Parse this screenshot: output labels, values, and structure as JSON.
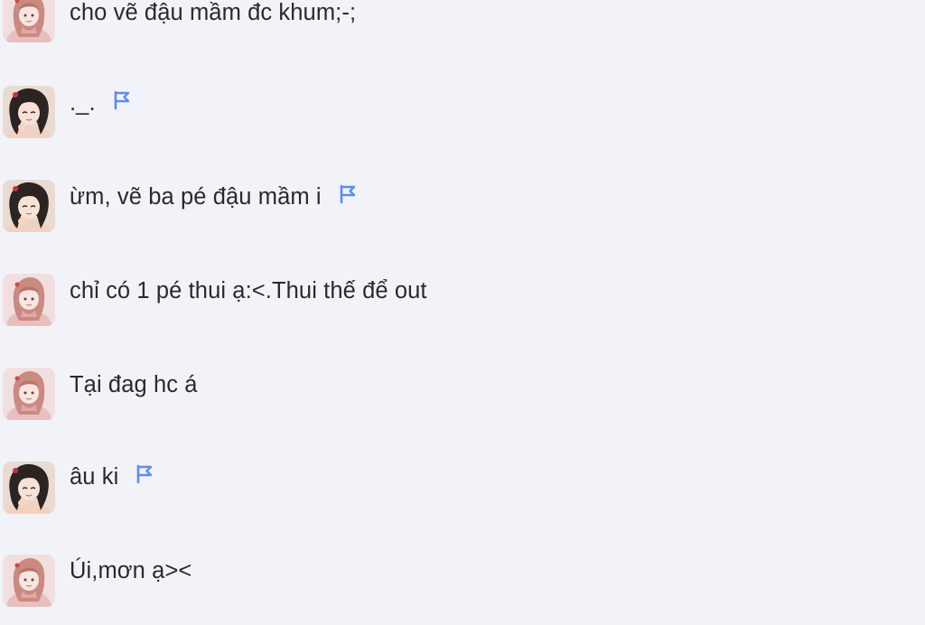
{
  "messages": [
    {
      "text": "cho vẽ đậu mầm đc khum;-;",
      "avatar": "avatar-girl-pink",
      "flag": false
    },
    {
      "text": "._.",
      "avatar": "avatar-girl-dark",
      "flag": true
    },
    {
      "text": "ừm, vẽ ba pé đậu mầm i",
      "avatar": "avatar-girl-dark",
      "flag": true
    },
    {
      "text": "chỉ có 1 pé thui ạ:<.Thui thế để out",
      "avatar": "avatar-girl-pink",
      "flag": false
    },
    {
      "text": "Tại đag hc á",
      "avatar": "avatar-girl-pink",
      "flag": false
    },
    {
      "text": "âu ki",
      "avatar": "avatar-girl-dark",
      "flag": true
    },
    {
      "text": "Úi,mơn ạ><",
      "avatar": "avatar-girl-pink",
      "flag": false
    }
  ],
  "colors": {
    "background": "#f2f3f8",
    "text": "#2a2a2a",
    "flag": "#5b8ef0"
  },
  "icons": {
    "flag": "flag-icon"
  }
}
